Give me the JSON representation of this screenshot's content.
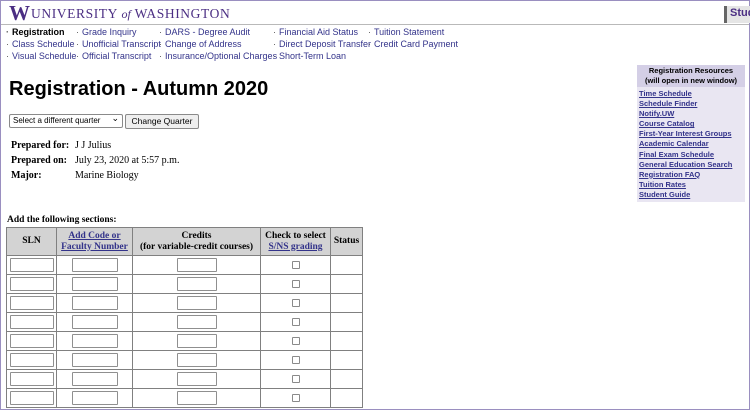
{
  "header": {
    "logo_w": "W",
    "university_prefix": "UNIVERSITY",
    "university_of": "of",
    "university_suffix": "WASHINGTON",
    "side_tab": "Stud"
  },
  "nav": {
    "col1": [
      "Registration",
      "Class Schedule",
      "Visual Schedule"
    ],
    "col2": [
      "Grade Inquiry",
      "Unofficial Transcript",
      "Official Transcript"
    ],
    "col3": [
      "DARS - Degree Audit",
      "Change of Address",
      "Insurance/Optional Charges"
    ],
    "col4": [
      "Financial Aid Status",
      "Direct Deposit Transfer",
      "Short-Term Loan"
    ],
    "col5": [
      "Tuition Statement",
      "Credit Card Payment"
    ]
  },
  "page": {
    "title": "Registration - Autumn 2020",
    "quarter_select": "Select a different quarter",
    "change_quarter": "Change Quarter"
  },
  "student": {
    "prepared_for_label": "Prepared for:",
    "prepared_for": "J J Julius",
    "prepared_on_label": "Prepared on:",
    "prepared_on": "July 23, 2020 at 5:57 p.m.",
    "major_label": "Major:",
    "major": "Marine Biology"
  },
  "sections": {
    "heading": "Add the following sections:",
    "col_sln": "SLN",
    "col_add_code_1": "Add Code or",
    "col_add_code_2": "Faculty Number",
    "col_credits_1": "Credits",
    "col_credits_2": "(for variable-credit courses)",
    "col_check_1": "Check to select",
    "col_check_2": "S/NS grading",
    "col_status": "Status"
  },
  "resources": {
    "title_1": "Registration Resources",
    "title_2": "(will open in new window)",
    "links": [
      "Time Schedule",
      "Schedule Finder",
      "Notify.UW",
      "Course Catalog",
      "First-Year Interest Groups",
      "Academic Calendar",
      "Final Exam Schedule",
      "General Education Search",
      "Registration FAQ",
      "Tuition Rates",
      "Student Guide"
    ]
  }
}
